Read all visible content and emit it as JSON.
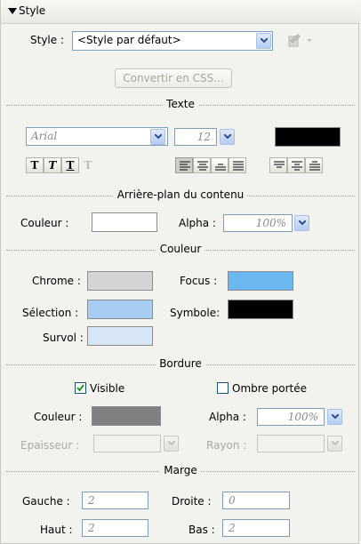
{
  "header": {
    "title": "Style"
  },
  "style_row": {
    "label": "Style :",
    "value": "<Style par défaut>"
  },
  "convert_button": "Convertir en CSS...",
  "sections": {
    "texte": "Texte",
    "arriere_plan": "Arrière-plan du contenu",
    "couleur": "Couleur",
    "bordure": "Bordure",
    "marge": "Marge"
  },
  "text": {
    "font": "Arial",
    "size": "12",
    "color": "#000000",
    "format_buttons": [
      "T",
      "T",
      "T",
      "T"
    ]
  },
  "background": {
    "color_label": "Couleur :",
    "color": "#ffffff",
    "alpha_label": "Alpha :",
    "alpha": "100%"
  },
  "colors": {
    "chrome_label": "Chrome :",
    "chrome": "#d4d4d4",
    "focus_label": "Focus :",
    "focus": "#6bb7ef",
    "selection_label": "Sélection :",
    "selection": "#a7cdf3",
    "symbol_label": "Symbole:",
    "symbol": "#000000",
    "hover_label": "Survol :",
    "hover": "#d6e6f6"
  },
  "border": {
    "visible_label": "Visible",
    "visible_checked": true,
    "shadow_label": "Ombre portée",
    "shadow_checked": false,
    "color_label": "Couleur :",
    "color": "#808080",
    "alpha_label": "Alpha :",
    "alpha": "100%",
    "thickness_label": "Epaisseur :",
    "radius_label": "Rayon :"
  },
  "margin": {
    "left_label": "Gauche :",
    "left": "2",
    "right_label": "Droite :",
    "right": "0",
    "top_label": "Haut :",
    "top": "2",
    "bottom_label": "Bas :",
    "bottom": "2"
  }
}
